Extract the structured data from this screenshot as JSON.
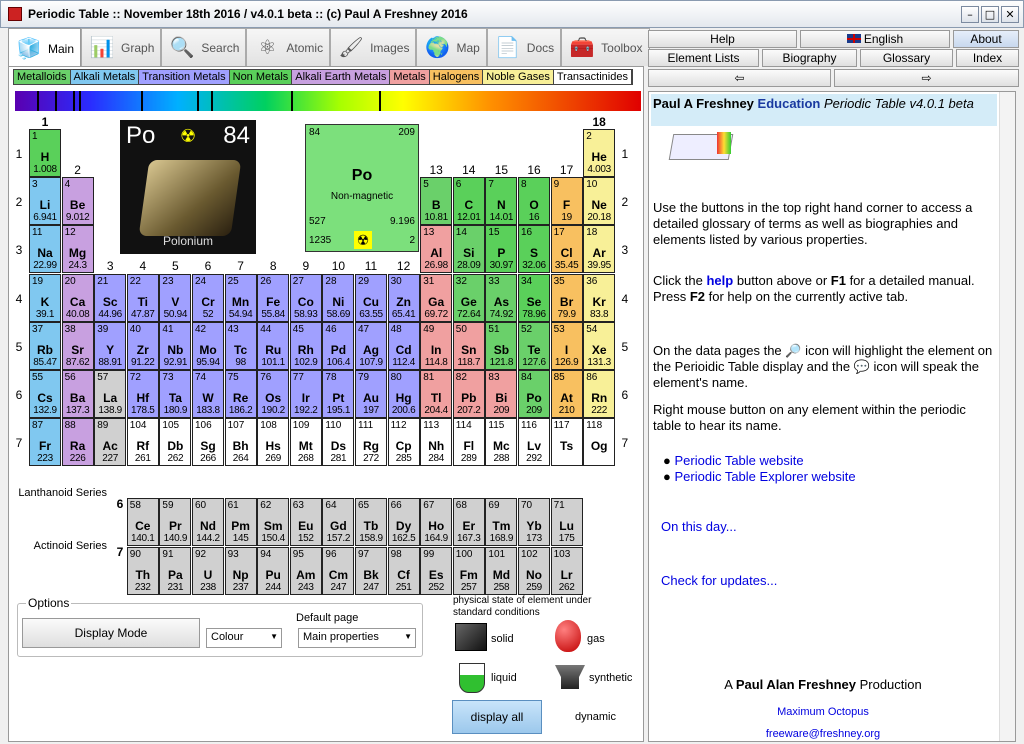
{
  "window": {
    "title": "Periodic Table :: November 18th 2016 / v4.0.1 beta :: (c) Paul A Freshney 2016"
  },
  "tabs": [
    {
      "label": "Main",
      "icon": "blocks-icon"
    },
    {
      "label": "Graph",
      "icon": "graph-icon"
    },
    {
      "label": "Search",
      "icon": "magnifier-icon"
    },
    {
      "label": "Atomic",
      "icon": "atom-icon"
    },
    {
      "label": "Images",
      "icon": "images-icon"
    },
    {
      "label": "Map",
      "icon": "globe-icon"
    },
    {
      "label": "Docs",
      "icon": "docs-icon"
    },
    {
      "label": "Toolbox",
      "icon": "toolbox-icon"
    }
  ],
  "categories": [
    {
      "label": "Metalloids",
      "color": "#6ad06a"
    },
    {
      "label": "Alkali Metals",
      "color": "#80c8f0"
    },
    {
      "label": "Transition Metals",
      "color": "#a0a0ff"
    },
    {
      "label": "Non Metals",
      "color": "#5ad05a"
    },
    {
      "label": "Alkali Earth Metals",
      "color": "#c8a0e0"
    },
    {
      "label": "Metals",
      "color": "#f0a0a0"
    },
    {
      "label": "Halogens",
      "color": "#f8c060"
    },
    {
      "label": "Noble Gases",
      "color": "#f8f098"
    },
    {
      "label": "Transactinides",
      "color": "#ffffff"
    }
  ],
  "groups": [
    "1",
    "2",
    "3",
    "4",
    "5",
    "6",
    "7",
    "8",
    "9",
    "10",
    "11",
    "12",
    "13",
    "14",
    "15",
    "16",
    "17",
    "18"
  ],
  "periods": [
    "1",
    "2",
    "3",
    "4",
    "5",
    "6",
    "7"
  ],
  "featured": {
    "number": "84",
    "mass": "209",
    "symbol": "Po",
    "state": "Non-magnetic",
    "v1": "527",
    "v2": "9.196",
    "v3": "1235",
    "v4": "2",
    "photo_symbol": "Po",
    "photo_number": "84",
    "photo_name": "Polonium"
  },
  "elements": [
    [
      "1",
      "H",
      "1.008",
      1,
      1,
      "nm"
    ],
    [
      "2",
      "He",
      "4.003",
      18,
      1,
      "ng"
    ],
    [
      "3",
      "Li",
      "6.941",
      1,
      2,
      "ak"
    ],
    [
      "4",
      "Be",
      "9.012",
      2,
      2,
      "ae"
    ],
    [
      "5",
      "B",
      "10.81",
      13,
      2,
      "ml"
    ],
    [
      "6",
      "C",
      "12.01",
      14,
      2,
      "nm"
    ],
    [
      "7",
      "N",
      "14.01",
      15,
      2,
      "nm"
    ],
    [
      "8",
      "O",
      "16",
      16,
      2,
      "nm"
    ],
    [
      "9",
      "F",
      "19",
      17,
      2,
      "ha"
    ],
    [
      "10",
      "Ne",
      "20.18",
      18,
      2,
      "ng"
    ],
    [
      "11",
      "Na",
      "22.99",
      1,
      3,
      "ak"
    ],
    [
      "12",
      "Mg",
      "24.3",
      2,
      3,
      "ae"
    ],
    [
      "13",
      "Al",
      "26.98",
      13,
      3,
      "me"
    ],
    [
      "14",
      "Si",
      "28.09",
      14,
      3,
      "ml"
    ],
    [
      "15",
      "P",
      "30.97",
      15,
      3,
      "nm"
    ],
    [
      "16",
      "S",
      "32.06",
      16,
      3,
      "nm"
    ],
    [
      "17",
      "Cl",
      "35.45",
      17,
      3,
      "ha"
    ],
    [
      "18",
      "Ar",
      "39.95",
      18,
      3,
      "ng"
    ],
    [
      "19",
      "K",
      "39.1",
      1,
      4,
      "ak"
    ],
    [
      "20",
      "Ca",
      "40.08",
      2,
      4,
      "ae"
    ],
    [
      "21",
      "Sc",
      "44.96",
      3,
      4,
      "tm"
    ],
    [
      "22",
      "Ti",
      "47.87",
      4,
      4,
      "tm"
    ],
    [
      "23",
      "V",
      "50.94",
      5,
      4,
      "tm"
    ],
    [
      "24",
      "Cr",
      "52",
      6,
      4,
      "tm"
    ],
    [
      "25",
      "Mn",
      "54.94",
      7,
      4,
      "tm"
    ],
    [
      "26",
      "Fe",
      "55.84",
      8,
      4,
      "tm"
    ],
    [
      "27",
      "Co",
      "58.93",
      9,
      4,
      "tm"
    ],
    [
      "28",
      "Ni",
      "58.69",
      10,
      4,
      "tm"
    ],
    [
      "29",
      "Cu",
      "63.55",
      11,
      4,
      "tm"
    ],
    [
      "30",
      "Zn",
      "65.41",
      12,
      4,
      "tm"
    ],
    [
      "31",
      "Ga",
      "69.72",
      13,
      4,
      "me"
    ],
    [
      "32",
      "Ge",
      "72.64",
      14,
      4,
      "ml"
    ],
    [
      "33",
      "As",
      "74.92",
      15,
      4,
      "ml"
    ],
    [
      "34",
      "Se",
      "78.96",
      16,
      4,
      "nm"
    ],
    [
      "35",
      "Br",
      "79.9",
      17,
      4,
      "ha"
    ],
    [
      "36",
      "Kr",
      "83.8",
      18,
      4,
      "ng"
    ],
    [
      "37",
      "Rb",
      "85.47",
      1,
      5,
      "ak"
    ],
    [
      "38",
      "Sr",
      "87.62",
      2,
      5,
      "ae"
    ],
    [
      "39",
      "Y",
      "88.91",
      3,
      5,
      "tm"
    ],
    [
      "40",
      "Zr",
      "91.22",
      4,
      5,
      "tm"
    ],
    [
      "41",
      "Nb",
      "92.91",
      5,
      5,
      "tm"
    ],
    [
      "42",
      "Mo",
      "95.94",
      6,
      5,
      "tm"
    ],
    [
      "43",
      "Tc",
      "98",
      7,
      5,
      "tm"
    ],
    [
      "44",
      "Ru",
      "101.1",
      8,
      5,
      "tm"
    ],
    [
      "45",
      "Rh",
      "102.9",
      9,
      5,
      "tm"
    ],
    [
      "46",
      "Pd",
      "106.4",
      10,
      5,
      "tm"
    ],
    [
      "47",
      "Ag",
      "107.9",
      11,
      5,
      "tm"
    ],
    [
      "48",
      "Cd",
      "112.4",
      12,
      5,
      "tm"
    ],
    [
      "49",
      "In",
      "114.8",
      13,
      5,
      "me"
    ],
    [
      "50",
      "Sn",
      "118.7",
      14,
      5,
      "me"
    ],
    [
      "51",
      "Sb",
      "121.8",
      15,
      5,
      "ml"
    ],
    [
      "52",
      "Te",
      "127.6",
      16,
      5,
      "ml"
    ],
    [
      "53",
      "I",
      "126.9",
      17,
      5,
      "ha"
    ],
    [
      "54",
      "Xe",
      "131.3",
      18,
      5,
      "ng"
    ],
    [
      "55",
      "Cs",
      "132.9",
      1,
      6,
      "ak"
    ],
    [
      "56",
      "Ba",
      "137.3",
      2,
      6,
      "ae"
    ],
    [
      "57",
      "La",
      "138.9",
      3,
      6,
      "la"
    ],
    [
      "72",
      "Hf",
      "178.5",
      4,
      6,
      "tm"
    ],
    [
      "73",
      "Ta",
      "180.9",
      5,
      6,
      "tm"
    ],
    [
      "74",
      "W",
      "183.8",
      6,
      6,
      "tm"
    ],
    [
      "75",
      "Re",
      "186.2",
      7,
      6,
      "tm"
    ],
    [
      "76",
      "Os",
      "190.2",
      8,
      6,
      "tm"
    ],
    [
      "77",
      "Ir",
      "192.2",
      9,
      6,
      "tm"
    ],
    [
      "78",
      "Pt",
      "195.1",
      10,
      6,
      "tm"
    ],
    [
      "79",
      "Au",
      "197",
      11,
      6,
      "tm"
    ],
    [
      "80",
      "Hg",
      "200.6",
      12,
      6,
      "tm"
    ],
    [
      "81",
      "Tl",
      "204.4",
      13,
      6,
      "me"
    ],
    [
      "82",
      "Pb",
      "207.2",
      14,
      6,
      "me"
    ],
    [
      "83",
      "Bi",
      "209",
      15,
      6,
      "me"
    ],
    [
      "84",
      "Po",
      "209",
      16,
      6,
      "ml"
    ],
    [
      "85",
      "At",
      "210",
      17,
      6,
      "ha"
    ],
    [
      "86",
      "Rn",
      "222",
      18,
      6,
      "ng"
    ],
    [
      "87",
      "Fr",
      "223",
      1,
      7,
      "ak"
    ],
    [
      "88",
      "Ra",
      "226",
      2,
      7,
      "ae"
    ],
    [
      "89",
      "Ac",
      "227",
      3,
      7,
      "la"
    ],
    [
      "104",
      "Rf",
      "261",
      4,
      7,
      "tr"
    ],
    [
      "105",
      "Db",
      "262",
      5,
      7,
      "tr"
    ],
    [
      "106",
      "Sg",
      "266",
      6,
      7,
      "tr"
    ],
    [
      "107",
      "Bh",
      "264",
      7,
      7,
      "tr"
    ],
    [
      "108",
      "Hs",
      "269",
      8,
      7,
      "tr"
    ],
    [
      "109",
      "Mt",
      "268",
      9,
      7,
      "tr"
    ],
    [
      "110",
      "Ds",
      "281",
      10,
      7,
      "tr"
    ],
    [
      "111",
      "Rg",
      "272",
      11,
      7,
      "tr"
    ],
    [
      "112",
      "Cp",
      "285",
      12,
      7,
      "tr"
    ],
    [
      "113",
      "Nh",
      "284",
      13,
      7,
      "tr"
    ],
    [
      "114",
      "Fl",
      "289",
      14,
      7,
      "tr"
    ],
    [
      "115",
      "Mc",
      "288",
      15,
      7,
      "tr"
    ],
    [
      "116",
      "Lv",
      "292",
      16,
      7,
      "tr"
    ],
    [
      "117",
      "Ts",
      "",
      17,
      7,
      "tr"
    ],
    [
      "118",
      "Og",
      "",
      18,
      7,
      "tr"
    ]
  ],
  "lanthanides": [
    [
      "58",
      "Ce",
      "140.1"
    ],
    [
      "59",
      "Pr",
      "140.9"
    ],
    [
      "60",
      "Nd",
      "144.2"
    ],
    [
      "61",
      "Pm",
      "145"
    ],
    [
      "62",
      "Sm",
      "150.4"
    ],
    [
      "63",
      "Eu",
      "152"
    ],
    [
      "64",
      "Gd",
      "157.2"
    ],
    [
      "65",
      "Tb",
      "158.9"
    ],
    [
      "66",
      "Dy",
      "162.5"
    ],
    [
      "67",
      "Ho",
      "164.9"
    ],
    [
      "68",
      "Er",
      "167.3"
    ],
    [
      "69",
      "Tm",
      "168.9"
    ],
    [
      "70",
      "Yb",
      "173"
    ],
    [
      "71",
      "Lu",
      "175"
    ]
  ],
  "actinides": [
    [
      "90",
      "Th",
      "232"
    ],
    [
      "91",
      "Pa",
      "231"
    ],
    [
      "92",
      "U",
      "238"
    ],
    [
      "93",
      "Np",
      "237"
    ],
    [
      "94",
      "Pu",
      "244"
    ],
    [
      "95",
      "Am",
      "243"
    ],
    [
      "96",
      "Cm",
      "247"
    ],
    [
      "97",
      "Bk",
      "247"
    ],
    [
      "98",
      "Cf",
      "251"
    ],
    [
      "99",
      "Es",
      "252"
    ],
    [
      "100",
      "Fm",
      "257"
    ],
    [
      "101",
      "Md",
      "258"
    ],
    [
      "102",
      "No",
      "259"
    ],
    [
      "103",
      "Lr",
      "262"
    ]
  ],
  "series": {
    "lanthanoid": "Lanthanoid Series",
    "lanthanoid_num": "6",
    "actinoid": "Actinoid Series",
    "actinoid_num": "7"
  },
  "options": {
    "legend": "Options",
    "display_mode": "Display Mode",
    "colour": "Colour",
    "default_page_label": "Default page",
    "default_page": "Main properties"
  },
  "state": {
    "title": "physical state of element under standard conditions",
    "solid": "solid",
    "gas": "gas",
    "liquid": "liquid",
    "synthetic": "synthetic",
    "display_all": "display all",
    "dynamic": "dynamic"
  },
  "right_buttons": {
    "help": "Help",
    "english": "English",
    "about": "About",
    "element_lists": "Element Lists",
    "biography": "Biography",
    "glossary": "Glossary",
    "index": "Index",
    "prev": "⇦",
    "next": "⇨"
  },
  "info": {
    "h1": "Paul A Freshney",
    "h2": "Education",
    "h3": "Periodic Table v4.0.1 beta",
    "p1": "Use the buttons in the top right hand corner to access a detailed glossary of terms as well as biographies and elements listed by various properties.",
    "p2a": "Click the ",
    "p2help": "help",
    "p2b": " button above or ",
    "p2f1": "F1",
    "p2c": " for a detailed manual. Press ",
    "p2f2": "F2",
    "p2d": " for help on the currently active tab.",
    "p3a": "On the data pages the ",
    "p3b": " icon will highlight the element on the Perioidic Table display and the ",
    "p3c": " icon will speak the element's name.",
    "p4": "Right mouse button on any element within the periodic table to hear its name.",
    "link1": "Periodic Table website",
    "link2": "Periodic Table Explorer website",
    "onthisday": "On this day...",
    "updates": "Check for updates...",
    "production_a": "A ",
    "production_b": "Paul Alan Freshney",
    "production_c": " Production",
    "company": "Maximum Octopus",
    "email": "freeware@freshney.org"
  }
}
